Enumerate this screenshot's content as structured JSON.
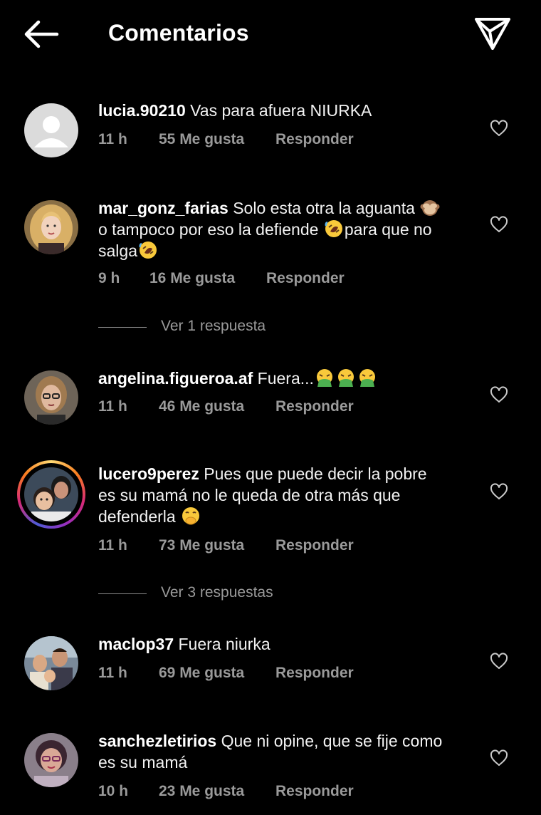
{
  "header": {
    "title": "Comentarios",
    "back_icon": "arrow-left-icon",
    "share_icon": "paper-plane-icon"
  },
  "comments": [
    {
      "username": "lucia.90210",
      "text": "Vas para afuera NIURKA",
      "time": "11 h",
      "likes": "55 Me gusta",
      "reply": "Responder"
    },
    {
      "username": "mar_gonz_farias",
      "text_1": "Solo esta otra la aguanta",
      "text_2": "o tampoco por eso la defiende",
      "text_3": "para que no",
      "text_4": "salga",
      "emoji_1": "🙈",
      "emoji_2": "🤣",
      "time": "9 h",
      "likes": "16 Me gusta",
      "reply": "Responder"
    },
    {
      "username": "angelina.figueroa.af",
      "text": "Fuera...",
      "emoji": "🤮",
      "time": "11 h",
      "likes": "46 Me gusta",
      "reply": "Responder"
    },
    {
      "username": "lucero9perez",
      "text_1": "Pues que puede decir la pobre",
      "text_2": "es su mamá no le queda de otra más que",
      "text_3": "defenderla",
      "emoji": "🤭",
      "time": "11 h",
      "likes": "73 Me gusta",
      "reply": "Responder"
    },
    {
      "username": "maclop37",
      "text": "Fuera niurka",
      "time": "11 h",
      "likes": "69 Me gusta",
      "reply": "Responder"
    },
    {
      "username": "sanchezletirios",
      "text_1": "Que ni opine, que se fije como",
      "text_2": "es su mamá",
      "time": "10 h",
      "likes": "23 Me gusta",
      "reply": "Responder"
    }
  ],
  "view_replies": {
    "one": "Ver 1 respuesta",
    "three": "Ver 3 respuestas"
  },
  "colors": {
    "background": "#000000",
    "meta_text": "#9a9a9a",
    "story_ring_start": "#feda75",
    "story_ring_end": "#d62976"
  }
}
